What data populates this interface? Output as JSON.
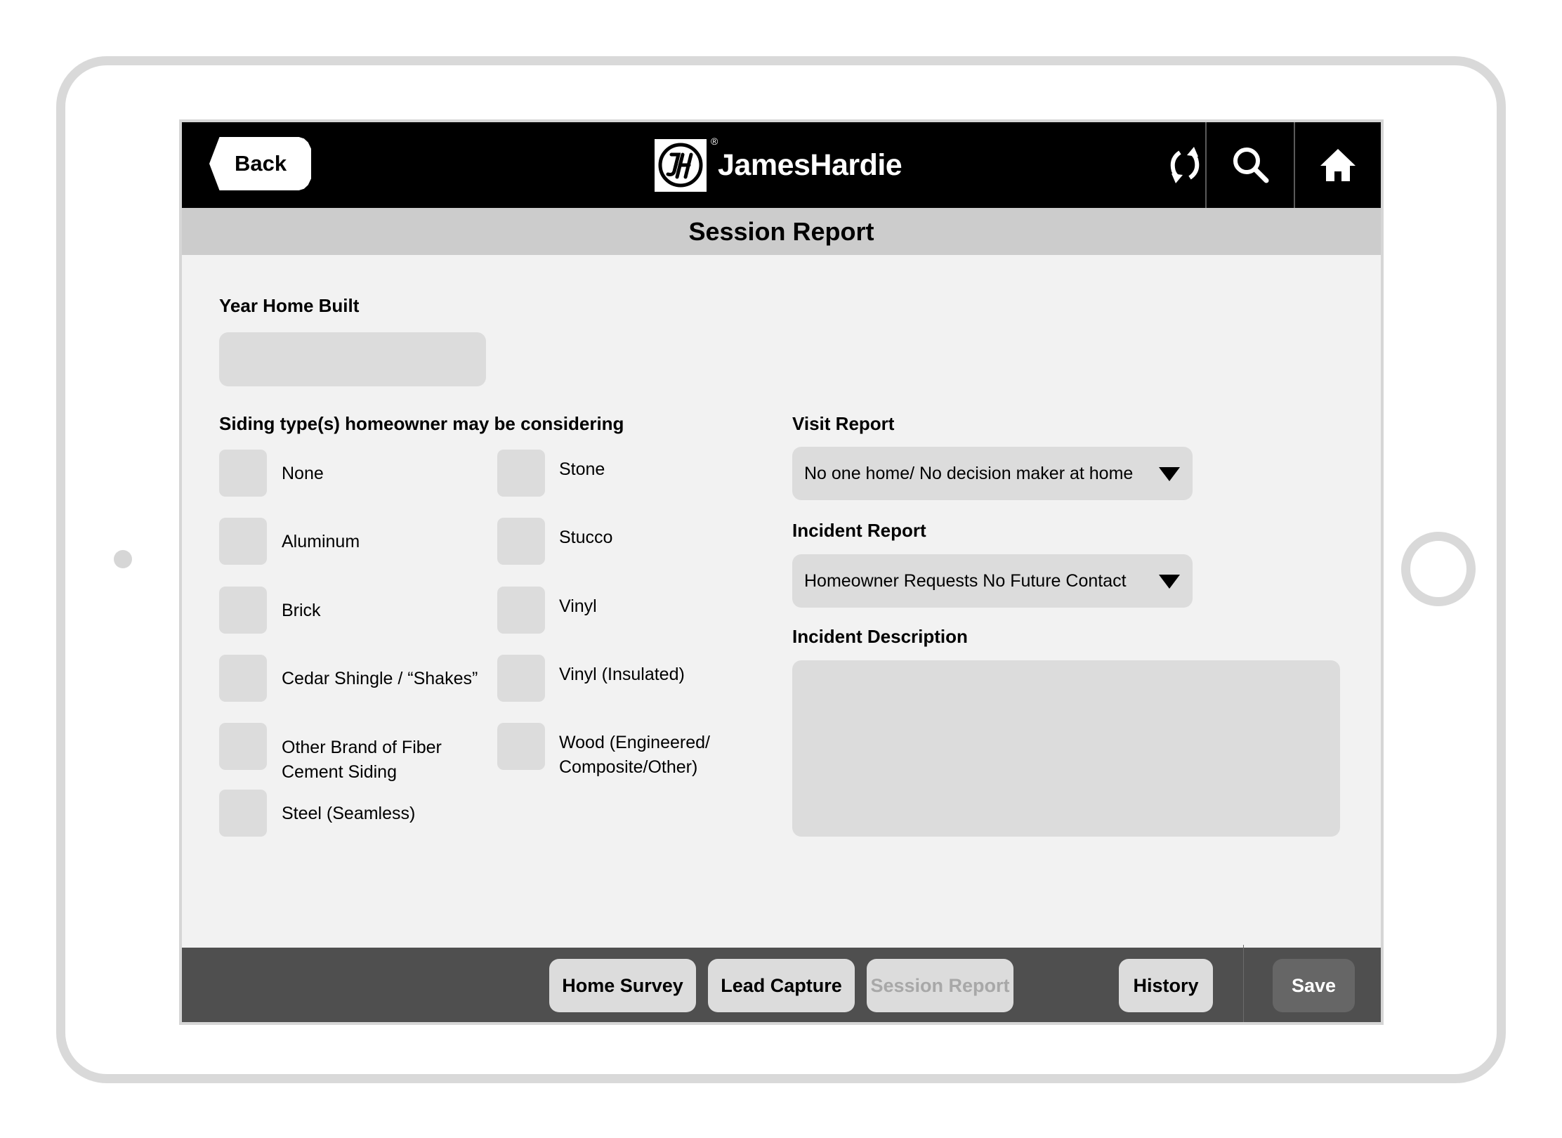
{
  "header": {
    "back_label": "Back",
    "brand": "JamesHardie",
    "brand_mark": "JH",
    "registered": "®",
    "icons": [
      "sync-icon",
      "search-icon",
      "home-icon"
    ]
  },
  "title": "Session Report",
  "form": {
    "year_home_built": {
      "label": "Year Home Built",
      "value": ""
    },
    "siding": {
      "label": "Siding type(s) homeowner may be considering",
      "left_options": [
        {
          "label": "None",
          "checked": false
        },
        {
          "label": "Aluminum",
          "checked": false
        },
        {
          "label": "Brick",
          "checked": false
        },
        {
          "label": "Cedar Shingle / “Shakes”",
          "checked": false
        },
        {
          "label": "Other Brand of Fiber Cement Siding",
          "checked": false
        },
        {
          "label": "Steel (Seamless)",
          "checked": false
        }
      ],
      "right_options": [
        {
          "label": "Stone",
          "checked": false
        },
        {
          "label": "Stucco",
          "checked": false
        },
        {
          "label": "Vinyl",
          "checked": false
        },
        {
          "label": "Vinyl (Insulated)",
          "checked": false
        },
        {
          "label": "Wood (Engineered/ Composite/Other)",
          "checked": false
        }
      ]
    },
    "visit_report": {
      "label": "Visit Report",
      "value": "No one home/ No decision maker at home"
    },
    "incident_report": {
      "label": "Incident Report",
      "value": "Homeowner Requests No Future Contact"
    },
    "incident_description": {
      "label": "Incident Description",
      "value": ""
    }
  },
  "bottom_nav": {
    "tabs": [
      {
        "label": "Home Survey",
        "active": false
      },
      {
        "label": "Lead Capture",
        "active": false
      },
      {
        "label": "Session Report",
        "active": true
      }
    ],
    "history_label": "History",
    "save_label": "Save"
  },
  "colors": {
    "header_bg": "#000000",
    "title_bar_bg": "#cccccc",
    "content_bg": "#f2f2f2",
    "field_bg": "#dcdcdc",
    "bottom_bar_bg": "#4f4f4f",
    "save_bg": "#666666",
    "disabled_text": "#a8a8a8"
  }
}
